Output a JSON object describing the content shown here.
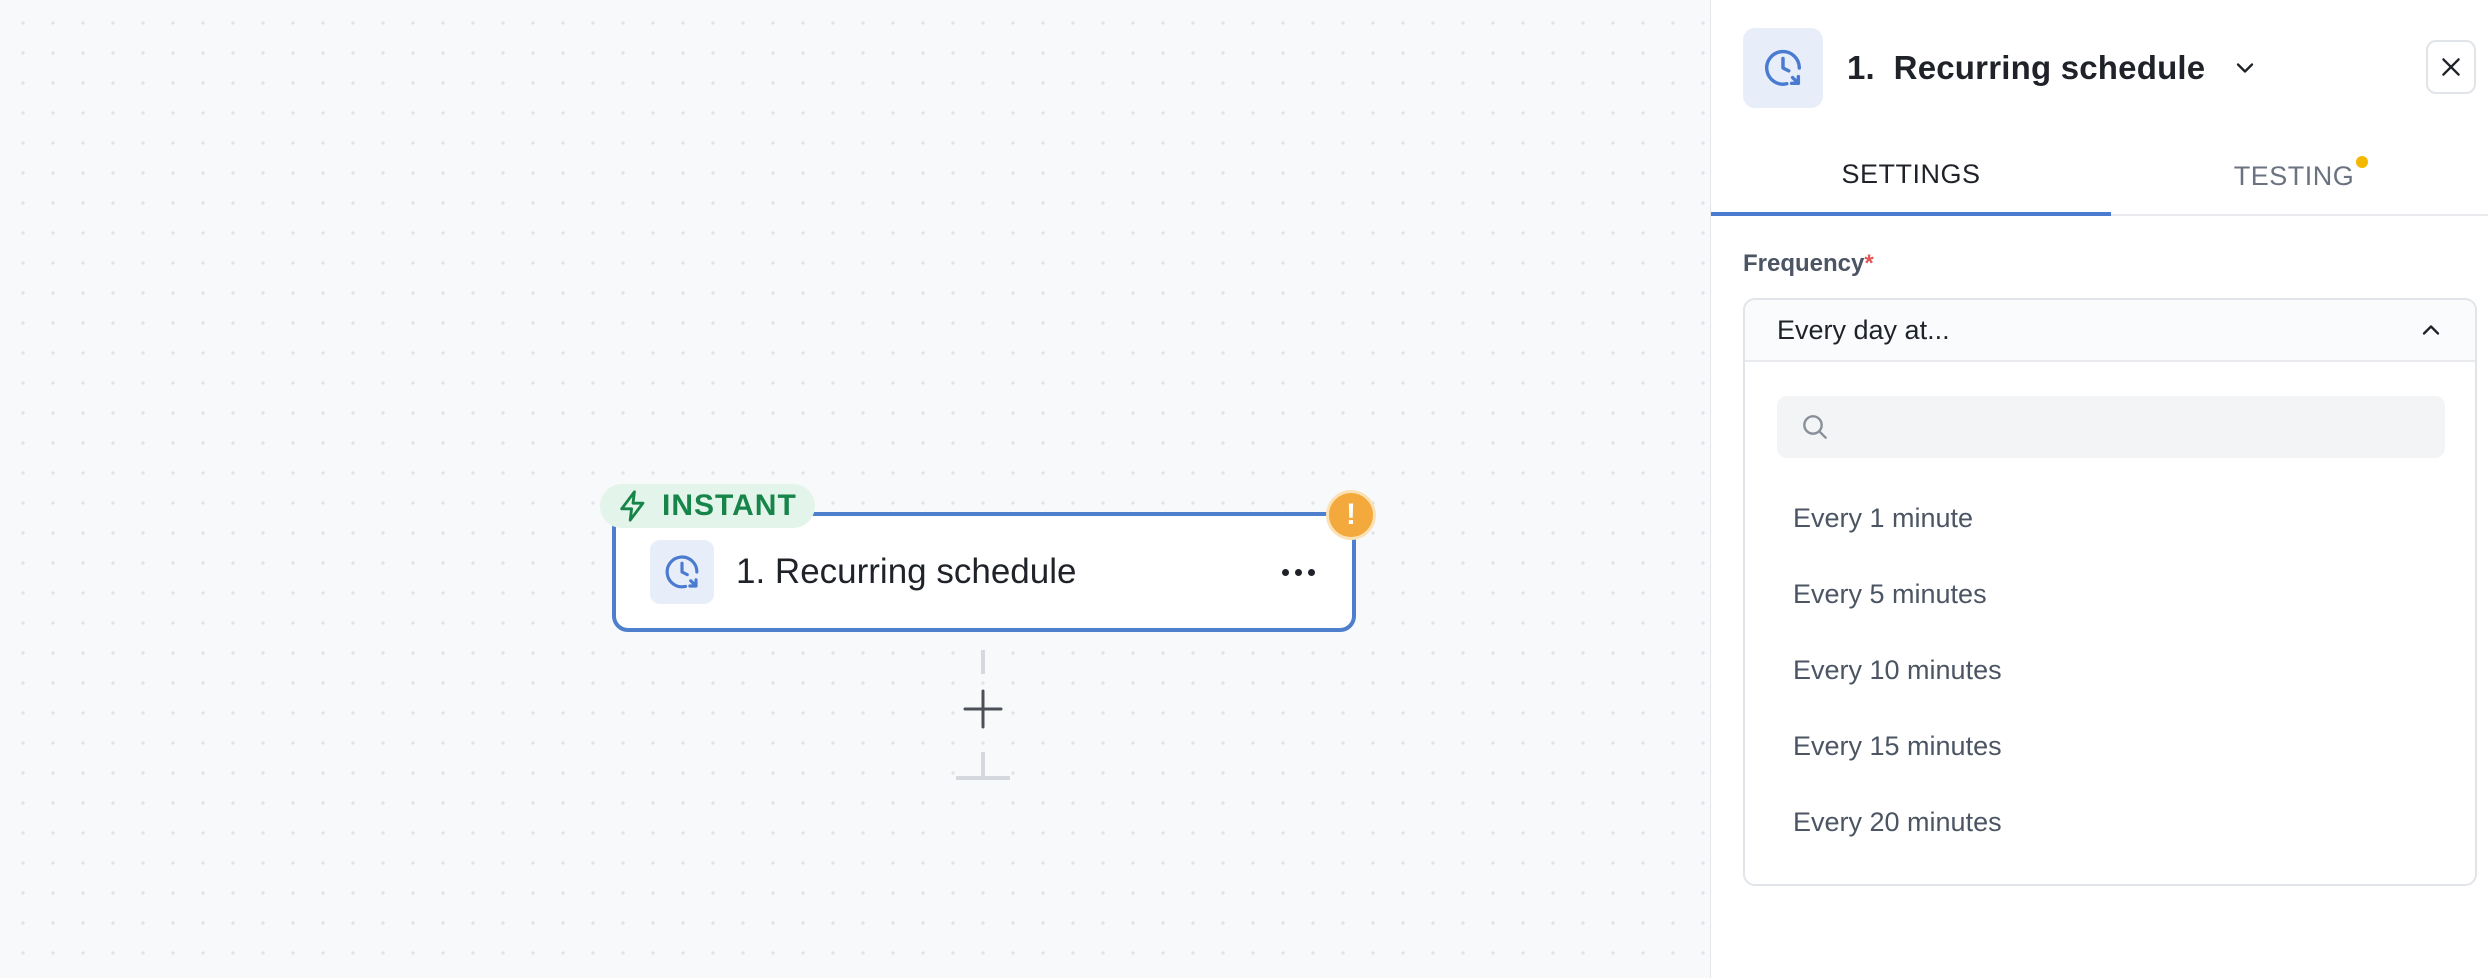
{
  "canvas": {
    "trigger_node": {
      "badge_label": "INSTANT",
      "title": "1. Recurring schedule",
      "warning_symbol": "!",
      "icon": "recurring-clock-icon",
      "badge_icon": "lightning-icon",
      "menu_icon": "more-horizontal-icon"
    },
    "add_step_icon": "plus-icon"
  },
  "panel": {
    "title": "1.  Recurring schedule",
    "header_icon": "recurring-clock-icon",
    "tabs": [
      {
        "label": "SETTINGS",
        "active": true
      },
      {
        "label": "TESTING",
        "active": false,
        "has_indicator": true
      }
    ],
    "frequency": {
      "label": "Frequency",
      "required_mark": "*",
      "selected_value": "Every day at...",
      "search_placeholder": "",
      "options": [
        "Every 1 minute",
        "Every 5 minutes",
        "Every 10 minutes",
        "Every 15 minutes",
        "Every 20 minutes"
      ]
    }
  },
  "colors": {
    "accent": "#4a7bd0",
    "instant_green": "#17854a",
    "warning": "#f3a93b",
    "indicator_yellow": "#f5b800",
    "required_red": "#e05757"
  }
}
